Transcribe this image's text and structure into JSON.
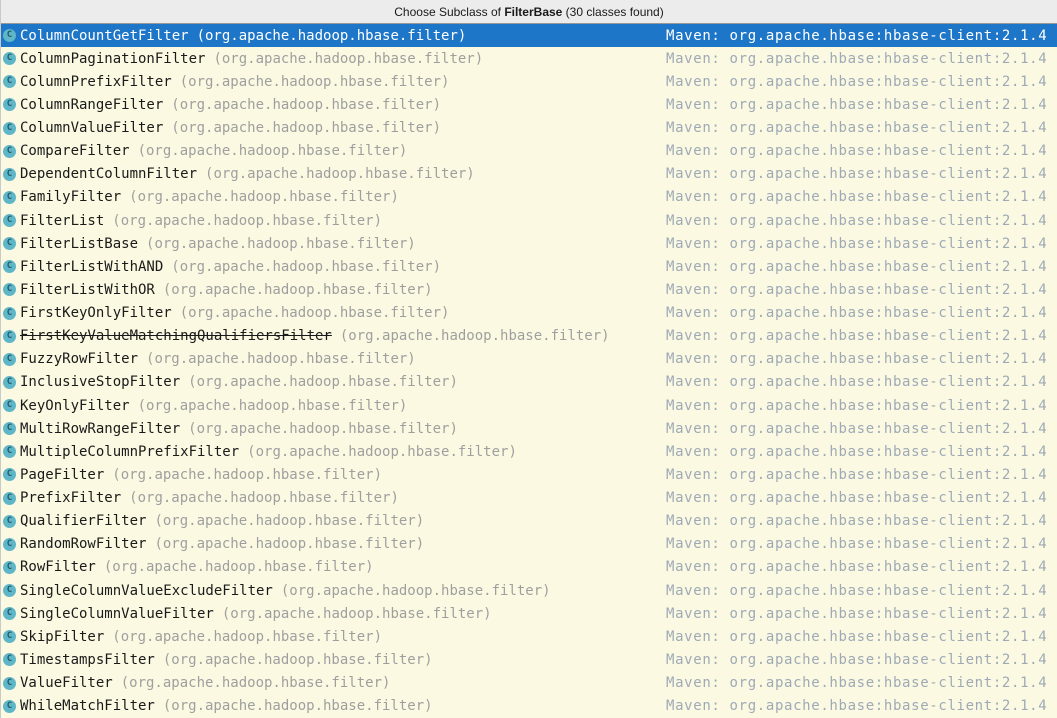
{
  "popup": {
    "title": {
      "prefix": "Choose Subclass of ",
      "highlight": "FilterBase",
      "suffix": " (30 classes found)"
    },
    "shared": {
      "package": "(org.apache.hadoop.hbase.filter)",
      "maven": "Maven: org.apache.hbase:hbase-client:2.1.4",
      "class_icon_letter": "C"
    },
    "colors": {
      "selection_background": "#1d76c8",
      "selection_text": "#ffffff",
      "list_background": "#fcf9e2",
      "titlebar_background": "#ececec",
      "titlebar_border": "#979797",
      "class_name_text": "#1a1a1a",
      "package_text": "#9f9f9f",
      "maven_text": "#9daab6",
      "icon_fill": "#5fb6c8",
      "icon_letter": "#1d5d68"
    },
    "items": [
      {
        "name": "ColumnCountGetFilter",
        "selected": true
      },
      {
        "name": "ColumnPaginationFilter"
      },
      {
        "name": "ColumnPrefixFilter"
      },
      {
        "name": "ColumnRangeFilter"
      },
      {
        "name": "ColumnValueFilter"
      },
      {
        "name": "CompareFilter"
      },
      {
        "name": "DependentColumnFilter"
      },
      {
        "name": "FamilyFilter"
      },
      {
        "name": "FilterList"
      },
      {
        "name": "FilterListBase"
      },
      {
        "name": "FilterListWithAND"
      },
      {
        "name": "FilterListWithOR"
      },
      {
        "name": "FirstKeyOnlyFilter"
      },
      {
        "name": "FirstKeyValueMatchingQualifiersFilter",
        "deprecated": true
      },
      {
        "name": "FuzzyRowFilter"
      },
      {
        "name": "InclusiveStopFilter"
      },
      {
        "name": "KeyOnlyFilter"
      },
      {
        "name": "MultiRowRangeFilter"
      },
      {
        "name": "MultipleColumnPrefixFilter"
      },
      {
        "name": "PageFilter"
      },
      {
        "name": "PrefixFilter"
      },
      {
        "name": "QualifierFilter"
      },
      {
        "name": "RandomRowFilter"
      },
      {
        "name": "RowFilter"
      },
      {
        "name": "SingleColumnValueExcludeFilter"
      },
      {
        "name": "SingleColumnValueFilter"
      },
      {
        "name": "SkipFilter"
      },
      {
        "name": "TimestampsFilter"
      },
      {
        "name": "ValueFilter"
      },
      {
        "name": "WhileMatchFilter"
      }
    ]
  }
}
